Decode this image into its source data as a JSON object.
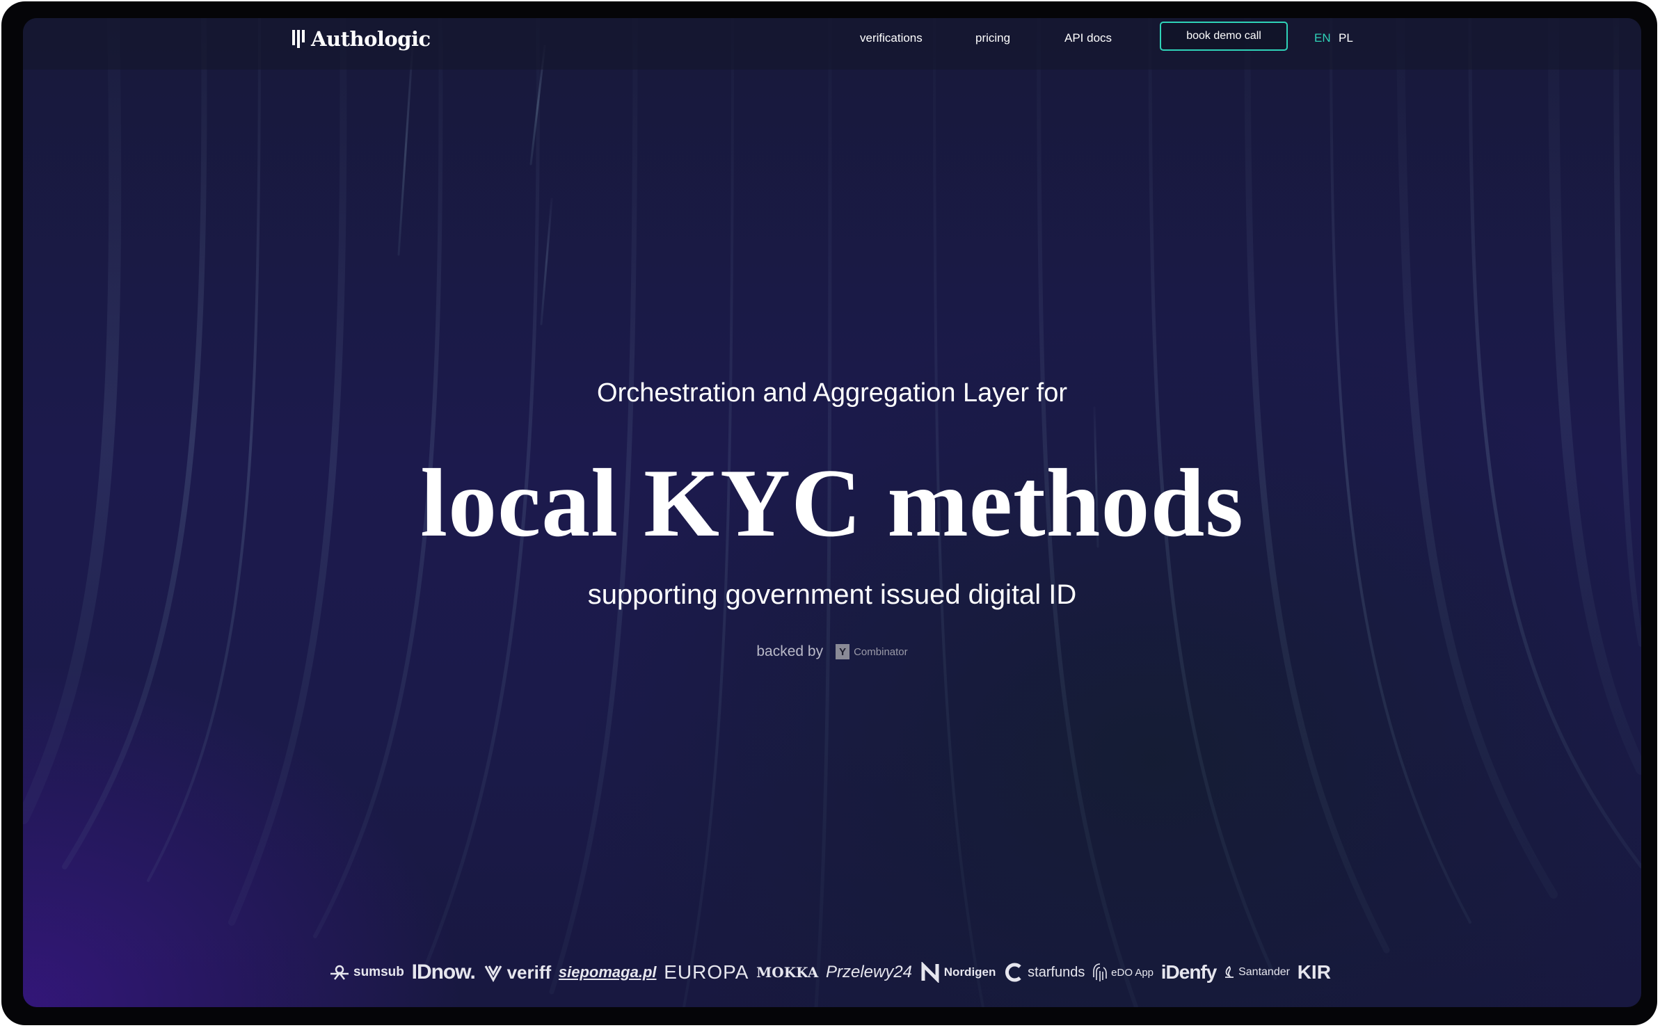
{
  "brand": {
    "name": "Authologic"
  },
  "nav": {
    "verifications": "verifications",
    "pricing": "pricing",
    "api_docs": "API docs",
    "book_demo": "book demo call",
    "lang_en": "EN",
    "lang_pl": "PL"
  },
  "hero": {
    "pre_title": "Orchestration and Aggregation Layer for",
    "title": "local KYC methods",
    "subtitle": "supporting government issued digital ID",
    "backed_by": "backed by",
    "backer_mark": "Y",
    "backer_name": "Combinator"
  },
  "partners": [
    "sumsub",
    "IDnow.",
    "veriff",
    "siepomaga.pl",
    "EUROPA",
    "MOKKA",
    "Przelewy24",
    "Nordigen",
    "starfunds",
    "eDO App",
    "iDenfy",
    "Santander",
    "KIR"
  ],
  "colors": {
    "accent": "#2fd3b8",
    "background": "#1b1a4a",
    "text": "#ffffff"
  },
  "icons": {
    "logo": "authologic-shield-icon",
    "yc": "y-combinator-icon"
  }
}
